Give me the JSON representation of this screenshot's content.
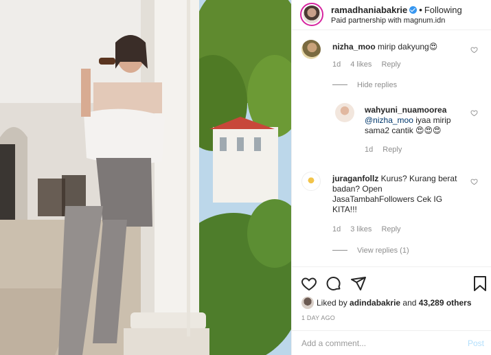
{
  "header": {
    "username": "ramadhaniabakrie",
    "follow_label": "Following",
    "subtitle": "Paid partnership with magnum.idn"
  },
  "comments": [
    {
      "username": "nizha_moo",
      "text": "mirip dakyung😍",
      "time": "1d",
      "likes": "4 likes",
      "reply": "Reply",
      "toggle": "Hide replies"
    },
    {
      "username": "wahyuni_nuamoorea",
      "mention": "@nizha_moo",
      "text": " iyaa mirip sama2 cantik 😍😍😍",
      "time": "1d",
      "reply": "Reply"
    },
    {
      "username": "juraganfollz",
      "text": " Kurus? Kurang berat badan? Open JasaTambahFollowers Cek IG KITA!!!",
      "time": "1d",
      "likes": "3 likes",
      "reply": "Reply",
      "toggle": "View replies (1)"
    }
  ],
  "actions": {
    "icons": [
      "heart-icon",
      "comment-icon",
      "share-icon",
      "bookmark-icon"
    ],
    "liked_by_prefix": "Liked by",
    "liked_by_user": "adindabakrie",
    "liked_by_suffix": "and",
    "others_count": "43,289 others",
    "date": "1 DAY AGO"
  },
  "add_comment": {
    "placeholder": "Add a comment...",
    "post_label": "Post"
  },
  "colors": {
    "verified": "#3897f0",
    "post_disabled": "#b2dffc",
    "muted": "#8e8e8e"
  }
}
